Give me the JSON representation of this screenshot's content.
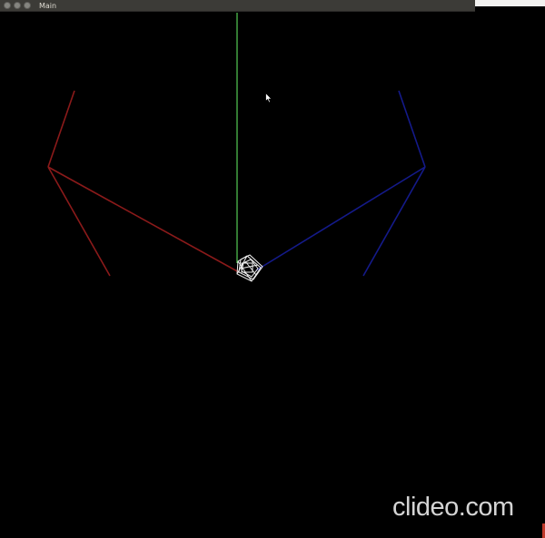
{
  "window": {
    "title": "Main"
  },
  "watermark": {
    "text": "clideo.com"
  },
  "colors": {
    "background": "#000000",
    "titlebar": "#3c3b37",
    "axis_x": "#8b1a1a",
    "axis_y": "#55cc55",
    "axis_z": "#141a8a",
    "model": "#f0f0f0"
  },
  "icons": {
    "close": "close-icon",
    "minimize": "minimize-icon",
    "maximize": "maximize-icon",
    "cursor": "mouse-pointer-icon"
  }
}
